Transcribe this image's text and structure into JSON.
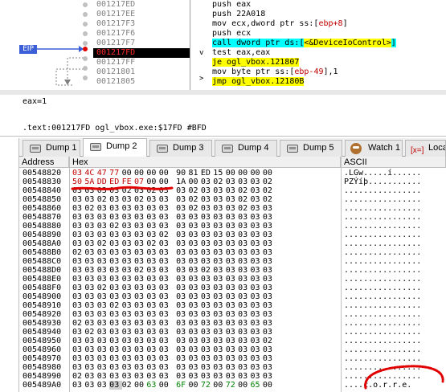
{
  "disasm": {
    "eip_label": "EIP",
    "addresses": [
      "001217ED",
      "001217EE",
      "001217F3",
      "001217F6",
      "001217F7",
      "001217FD",
      "001217FF",
      "00121801",
      "00121805"
    ],
    "current_address": "001217FD",
    "code": {
      "l0": "push eax",
      "l1": "push 22A018",
      "l2_a": "mov ecx,dword ptr ss:[",
      "l2_b": "ebp+8",
      "l2_c": "]",
      "l3": "push ecx",
      "l4_a": "call dword ptr ds:[",
      "l4_b": "<&DeviceIoControl>",
      "l4_c": "]",
      "l5": "test eax,eax",
      "l6": "je ogl_vbox.121807",
      "l7_a": "mov byte ptr ss:[",
      "l7_b": "ebp-49",
      "l7_c": "],1",
      "l8": "jmp ogl_vbox.12180B"
    },
    "jump_marks": {
      "m6": "v",
      "m8": ">"
    }
  },
  "info": {
    "line1": "eax=1",
    "line2": ".text:001217FD ogl_vbox.exe:$17FD #BFD"
  },
  "tabs": [
    {
      "label": "Dump 1",
      "icon": "dump-icon"
    },
    {
      "label": "Dump 2",
      "icon": "dump-icon"
    },
    {
      "label": "Dump 3",
      "icon": "dump-icon"
    },
    {
      "label": "Dump 4",
      "icon": "dump-icon"
    },
    {
      "label": "Dump 5",
      "icon": "dump-icon"
    },
    {
      "label": "Watch 1",
      "icon": "watch-icon"
    },
    {
      "label": "Loca",
      "icon": "locals-icon"
    }
  ],
  "active_tab": "Dump 2",
  "dump": {
    "headers": {
      "address": "Address",
      "hex": "Hex",
      "ascii": "ASCII"
    },
    "rows": [
      {
        "addr": "00548820",
        "hex": [
          "03",
          "4C",
          "47",
          "77",
          "00",
          "00",
          "00",
          "00",
          "90",
          "81",
          "ED",
          "15",
          "00",
          "00",
          "00",
          "00"
        ],
        "ascii": ".LGw.....í......"
      },
      {
        "addr": "00548830",
        "hex": [
          "50",
          "5A",
          "DD",
          "ED",
          "FE",
          "07",
          "00",
          "00",
          "1A",
          "00",
          "03",
          "02",
          "03",
          "03",
          "03",
          "02"
        ],
        "ascii": "PZÝíþ..........."
      },
      {
        "addr": "00548840",
        "hex": [
          "03",
          "03",
          "03",
          "03",
          "02",
          "03",
          "02",
          "03",
          "03",
          "02",
          "03",
          "03",
          "03",
          "02",
          "03",
          "02"
        ],
        "ascii": "................"
      },
      {
        "addr": "00548850",
        "hex": [
          "03",
          "03",
          "02",
          "03",
          "03",
          "02",
          "03",
          "03",
          "03",
          "02",
          "03",
          "03",
          "03",
          "02",
          "03",
          "02"
        ],
        "ascii": "................"
      },
      {
        "addr": "00548860",
        "hex": [
          "03",
          "02",
          "03",
          "03",
          "03",
          "03",
          "03",
          "03",
          "03",
          "02",
          "03",
          "03",
          "03",
          "02",
          "03",
          "03"
        ],
        "ascii": "................"
      },
      {
        "addr": "00548870",
        "hex": [
          "03",
          "03",
          "03",
          "03",
          "03",
          "03",
          "03",
          "03",
          "03",
          "03",
          "03",
          "03",
          "03",
          "03",
          "03",
          "03"
        ],
        "ascii": "................"
      },
      {
        "addr": "00548880",
        "hex": [
          "03",
          "03",
          "03",
          "02",
          "03",
          "03",
          "03",
          "03",
          "03",
          "03",
          "03",
          "03",
          "03",
          "03",
          "03",
          "03"
        ],
        "ascii": "................"
      },
      {
        "addr": "00548890",
        "hex": [
          "03",
          "03",
          "03",
          "03",
          "03",
          "03",
          "03",
          "02",
          "03",
          "03",
          "03",
          "03",
          "03",
          "03",
          "03",
          "03"
        ],
        "ascii": "................"
      },
      {
        "addr": "005488A0",
        "hex": [
          "03",
          "03",
          "02",
          "03",
          "03",
          "03",
          "02",
          "03",
          "03",
          "03",
          "03",
          "03",
          "03",
          "03",
          "03",
          "03"
        ],
        "ascii": "................"
      },
      {
        "addr": "005488B0",
        "hex": [
          "02",
          "03",
          "03",
          "03",
          "03",
          "03",
          "03",
          "03",
          "03",
          "03",
          "03",
          "03",
          "03",
          "03",
          "03",
          "03"
        ],
        "ascii": "................"
      },
      {
        "addr": "005488C0",
        "hex": [
          "03",
          "03",
          "03",
          "03",
          "03",
          "03",
          "03",
          "03",
          "03",
          "03",
          "03",
          "03",
          "03",
          "03",
          "03",
          "03"
        ],
        "ascii": "................"
      },
      {
        "addr": "005488D0",
        "hex": [
          "03",
          "03",
          "03",
          "03",
          "03",
          "02",
          "03",
          "03",
          "03",
          "03",
          "02",
          "03",
          "03",
          "03",
          "03",
          "03"
        ],
        "ascii": "................"
      },
      {
        "addr": "005488E0",
        "hex": [
          "03",
          "03",
          "03",
          "03",
          "03",
          "03",
          "03",
          "03",
          "03",
          "03",
          "03",
          "03",
          "03",
          "03",
          "03",
          "03"
        ],
        "ascii": "................"
      },
      {
        "addr": "005488F0",
        "hex": [
          "03",
          "03",
          "02",
          "03",
          "03",
          "03",
          "03",
          "03",
          "03",
          "03",
          "03",
          "03",
          "03",
          "03",
          "03",
          "03"
        ],
        "ascii": "................"
      },
      {
        "addr": "00548900",
        "hex": [
          "03",
          "03",
          "03",
          "03",
          "03",
          "03",
          "03",
          "03",
          "03",
          "03",
          "03",
          "03",
          "03",
          "03",
          "03",
          "03"
        ],
        "ascii": "................"
      },
      {
        "addr": "00548910",
        "hex": [
          "03",
          "03",
          "03",
          "02",
          "03",
          "03",
          "03",
          "03",
          "03",
          "03",
          "03",
          "03",
          "03",
          "03",
          "03",
          "03"
        ],
        "ascii": "................"
      },
      {
        "addr": "00548920",
        "hex": [
          "03",
          "03",
          "03",
          "03",
          "03",
          "03",
          "03",
          "03",
          "03",
          "03",
          "03",
          "03",
          "03",
          "03",
          "03",
          "03"
        ],
        "ascii": "................"
      },
      {
        "addr": "00548930",
        "hex": [
          "02",
          "03",
          "03",
          "03",
          "03",
          "03",
          "03",
          "03",
          "03",
          "03",
          "03",
          "03",
          "03",
          "03",
          "03",
          "03"
        ],
        "ascii": "................"
      },
      {
        "addr": "00548940",
        "hex": [
          "03",
          "02",
          "03",
          "03",
          "03",
          "03",
          "03",
          "03",
          "03",
          "03",
          "03",
          "03",
          "03",
          "03",
          "03",
          "03"
        ],
        "ascii": "................"
      },
      {
        "addr": "00548950",
        "hex": [
          "03",
          "03",
          "03",
          "03",
          "03",
          "03",
          "03",
          "03",
          "03",
          "03",
          "03",
          "03",
          "03",
          "03",
          "03",
          "02"
        ],
        "ascii": "................"
      },
      {
        "addr": "00548960",
        "hex": [
          "03",
          "03",
          "03",
          "03",
          "03",
          "03",
          "03",
          "03",
          "03",
          "03",
          "03",
          "03",
          "03",
          "03",
          "03",
          "03"
        ],
        "ascii": "................"
      },
      {
        "addr": "00548970",
        "hex": [
          "03",
          "03",
          "03",
          "03",
          "03",
          "03",
          "03",
          "03",
          "03",
          "03",
          "03",
          "03",
          "03",
          "03",
          "03",
          "03"
        ],
        "ascii": "................"
      },
      {
        "addr": "00548980",
        "hex": [
          "03",
          "03",
          "03",
          "03",
          "03",
          "03",
          "03",
          "03",
          "03",
          "03",
          "03",
          "03",
          "03",
          "03",
          "03",
          "03"
        ],
        "ascii": "................"
      },
      {
        "addr": "00548990",
        "hex": [
          "02",
          "03",
          "03",
          "03",
          "03",
          "03",
          "03",
          "03",
          "03",
          "03",
          "03",
          "03",
          "03",
          "03",
          "03",
          "03"
        ],
        "ascii": "................"
      },
      {
        "addr": "005489A0",
        "hex": [
          "03",
          "03",
          "03",
          "03",
          "02",
          "00",
          "63",
          "00",
          "6F",
          "00",
          "72",
          "00",
          "72",
          "00",
          "65",
          "00"
        ],
        "ascii": "....c.o.r.r.e."
      }
    ]
  },
  "colors": {
    "current_line_bg": "#000000",
    "current_addr_fg": "#ff2a2a",
    "highlight_yellow": "#ffff00",
    "highlight_cyan": "#00ffff",
    "eip_bg": "#3c5fd8",
    "annotation_red": "#e00000"
  }
}
